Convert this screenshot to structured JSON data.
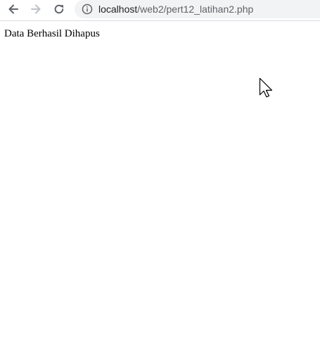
{
  "browser": {
    "url_host": "localhost",
    "url_path": "/web2/pert12_latihan2.php",
    "icons": {
      "back": "arrow-left-icon",
      "forward": "arrow-right-icon",
      "reload": "reload-icon",
      "info": "info-icon"
    }
  },
  "page": {
    "message": "Data Berhasil Dihapus"
  },
  "colors": {
    "omnibox_bg": "#f1f3f4",
    "nav_icon": "#5f6368",
    "nav_icon_disabled": "#bdc1c6"
  }
}
